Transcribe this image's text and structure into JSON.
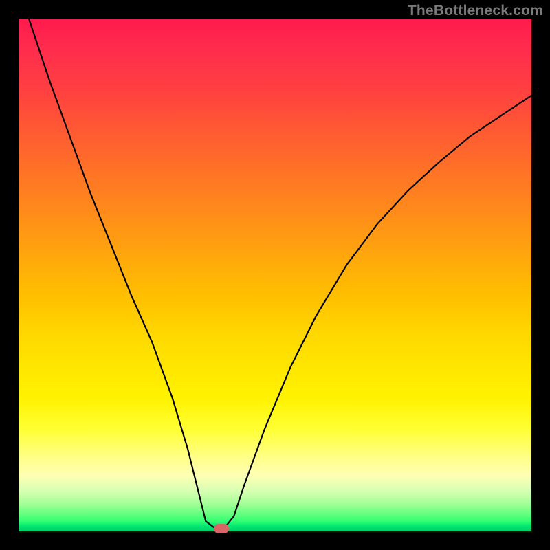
{
  "watermark": "TheBottleneck.com",
  "chart_data": {
    "type": "line",
    "title": "",
    "xlabel": "",
    "ylabel": "",
    "xlim": [
      0,
      100
    ],
    "ylim": [
      0,
      100
    ],
    "grid": false,
    "series": [
      {
        "name": "curve",
        "x": [
          2,
          6,
          10,
          14,
          18,
          22,
          26,
          30,
          33,
          35,
          36.5,
          38.5,
          40,
          42,
          44,
          48,
          53,
          58,
          64,
          70,
          76,
          82,
          88,
          94,
          100
        ],
        "values": [
          100,
          88,
          77,
          66,
          56,
          46,
          37,
          26,
          16,
          8,
          2,
          0.5,
          0.5,
          3,
          9,
          20,
          32,
          42,
          52,
          60,
          66.5,
          72,
          77,
          81,
          85
        ]
      }
    ],
    "marker": {
      "x": 39.5,
      "y": 0.5
    },
    "gradient_stops": [
      {
        "pos": 0,
        "color": "#ff1a4d"
      },
      {
        "pos": 50,
        "color": "#ffcc00"
      },
      {
        "pos": 85,
        "color": "#ffff80"
      },
      {
        "pos": 100,
        "color": "#00cc66"
      }
    ]
  }
}
